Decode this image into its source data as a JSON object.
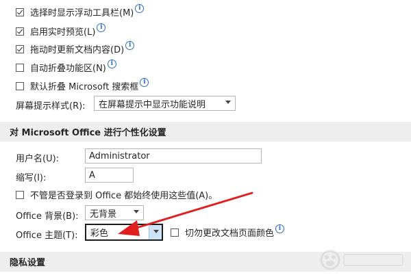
{
  "general": {
    "items": [
      {
        "label": "选择时显示浮动工具栏(M)",
        "checked": true
      },
      {
        "label": "启用实时预览(L)",
        "checked": true
      },
      {
        "label": "拖动时更新文档内容(D)",
        "checked": true
      },
      {
        "label": "自动折叠功能区(N)",
        "checked": false
      },
      {
        "label": "默认折叠 Microsoft 搜索框",
        "checked": false
      }
    ],
    "screentip_label": "屏幕提示样式(R):",
    "screentip_value": "在屏幕提示中显示功能说明",
    "info_glyph": "i"
  },
  "personalize": {
    "header": "对 Microsoft Office 进行个性化设置",
    "username_label": "用户名(U):",
    "username_value": "Administrator",
    "initials_label": "缩写(I):",
    "initials_value": "A",
    "always_use_label": "不管是否登录到 Office 都始终使用这些值(A)。",
    "always_use_checked": false,
    "background_label": "Office 背景(B):",
    "background_value": "无背景",
    "theme_label": "Office 主题(T):",
    "theme_value": "彩色",
    "never_change_color_label": "切勿更改文档页面颜色",
    "never_change_color_checked": false
  },
  "privacy": {
    "header": "隐私设置"
  },
  "colors": {
    "annotation_arrow": "#e02020",
    "info_icon": "#2b6cc4"
  }
}
